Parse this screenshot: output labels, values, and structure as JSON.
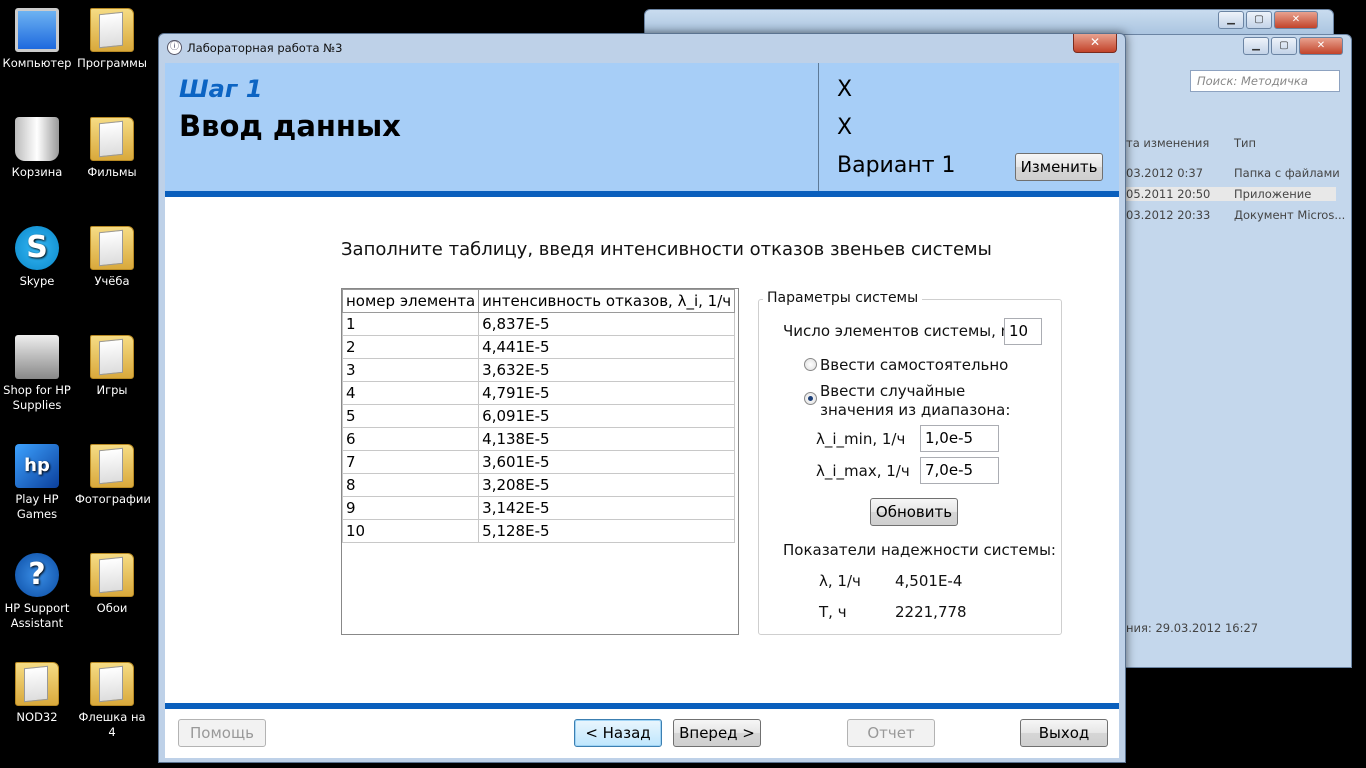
{
  "desktop": {
    "icons": [
      {
        "label": "Компьютер"
      },
      {
        "label": "Программы"
      },
      {
        "label": "Корзина"
      },
      {
        "label": "Фильмы"
      },
      {
        "label": "Skype"
      },
      {
        "label": "Учёба"
      },
      {
        "label": "Shop for HP Supplies"
      },
      {
        "label": "Игры"
      },
      {
        "label": "Play HP Games"
      },
      {
        "label": "Фотографии"
      },
      {
        "label": "HP Support Assistant"
      },
      {
        "label": "Обои"
      },
      {
        "label": "NOD32"
      },
      {
        "label": "Флешка на 4"
      }
    ]
  },
  "explorer": {
    "search_placeholder": "Поиск: Методичка",
    "col_date": "та изменения",
    "col_type": "Тип",
    "rows": [
      {
        "date": "03.2012 0:37",
        "type": "Папка с файлами"
      },
      {
        "date": "05.2011 20:50",
        "type": "Приложение"
      },
      {
        "date": "03.2012 20:33",
        "type": "Документ Micros..."
      }
    ],
    "status": "ния: 29.03.2012 16:27"
  },
  "dialog": {
    "title": "Лабораторная работа №3",
    "close_glyph": "✕",
    "header": {
      "step": "Шаг 1",
      "title": "Ввод данных",
      "line1": "X",
      "line2": "X",
      "variant": "Вариант 1",
      "change_button": "Изменить"
    },
    "instruction": "Заполните таблицу, введя интенсивности отказов звеньев системы",
    "table": {
      "headers": [
        "номер элемента",
        "интенсивность отказов, λ_i, 1/ч"
      ],
      "rows": [
        [
          "1",
          "6,837E-5"
        ],
        [
          "2",
          "4,441E-5"
        ],
        [
          "3",
          "3,632E-5"
        ],
        [
          "4",
          "4,791E-5"
        ],
        [
          "5",
          "6,091E-5"
        ],
        [
          "6",
          "4,138E-5"
        ],
        [
          "7",
          "3,601E-5"
        ],
        [
          "8",
          "3,208E-5"
        ],
        [
          "9",
          "3,142E-5"
        ],
        [
          "10",
          "5,128E-5"
        ]
      ]
    },
    "params": {
      "legend": "Параметры системы",
      "n_label": "Число элементов системы, n",
      "n_value": "10",
      "radio_manual": "Ввести самостоятельно",
      "radio_random_line1": "Ввести случайные",
      "radio_random_line2": "значения из диапазона:",
      "lmin_label": "λ_i_min, 1/ч",
      "lmin_value": "1,0e-5",
      "lmax_label": "λ_i_max, 1/ч",
      "lmax_value": "7,0e-5",
      "update_button": "Обновить",
      "reliability_title": "Показатели надежности системы:",
      "lambda_label": "λ, 1/ч",
      "lambda_value": "4,501E-4",
      "t_label": "T, ч",
      "t_value": "2221,778"
    },
    "footer": {
      "help": "Помощь",
      "back": "< Назад",
      "next": "Вперед >",
      "report": "Отчет",
      "exit": "Выход"
    }
  }
}
